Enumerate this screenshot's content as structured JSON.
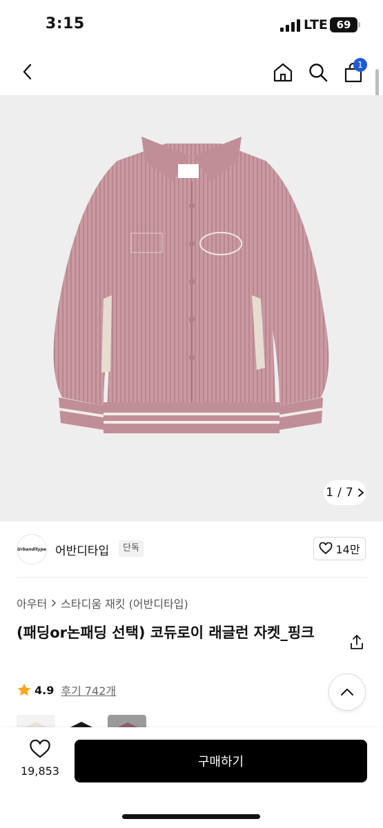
{
  "status_bar": {
    "time": "3:15",
    "network": "LTE",
    "battery": "69"
  },
  "nav": {
    "cart_count": "1"
  },
  "gallery": {
    "current": "1",
    "separator": "/",
    "total": "7"
  },
  "brand": {
    "logo_text": "Urbanditype",
    "name": "어반디타입",
    "tag": "단독",
    "likes": "14만"
  },
  "breadcrumb": {
    "category": "아우터",
    "subcategory": "스타디움 재킷 (어반디타입)"
  },
  "product": {
    "title": "(패딩or논패딩 선택) 코듀로이 래글런 자켓_핑크"
  },
  "rating": {
    "score": "4.9",
    "reviews": "후기 742개"
  },
  "bottom_bar": {
    "wish_count": "19,853",
    "buy_label": "구매하기"
  },
  "colors": {
    "accent": "#1e5bd6",
    "star": "#f5a623",
    "jacket": "#c99aa2"
  },
  "icons": [
    "chevron-left-icon",
    "home-icon",
    "search-icon",
    "cart-icon",
    "chevron-right-icon",
    "heart-icon",
    "share-icon",
    "chevron-up-icon",
    "star-icon"
  ]
}
